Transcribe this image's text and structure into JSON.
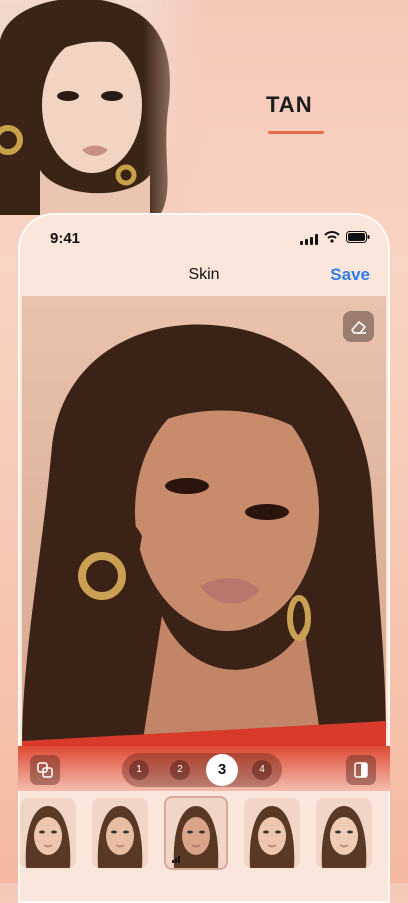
{
  "promo": {
    "title": "TAN"
  },
  "status_bar": {
    "time": "9:41",
    "icons": [
      "signal-icon",
      "wifi-icon",
      "battery-icon"
    ]
  },
  "nav": {
    "title": "Skin",
    "save_label": "Save"
  },
  "editor": {
    "eraser_icon": "eraser-icon"
  },
  "toolbar": {
    "left_icon": "compare-layers-icon",
    "right_icon": "before-after-icon",
    "levels": [
      "1",
      "2",
      "3",
      "4"
    ],
    "selected_level": "3"
  },
  "thumbnails": {
    "count": 5,
    "selected_index": 2,
    "selected_icon": "strength-bars-icon"
  },
  "colors": {
    "accent": "#e86a4d",
    "save_blue": "#2f7ee6"
  }
}
